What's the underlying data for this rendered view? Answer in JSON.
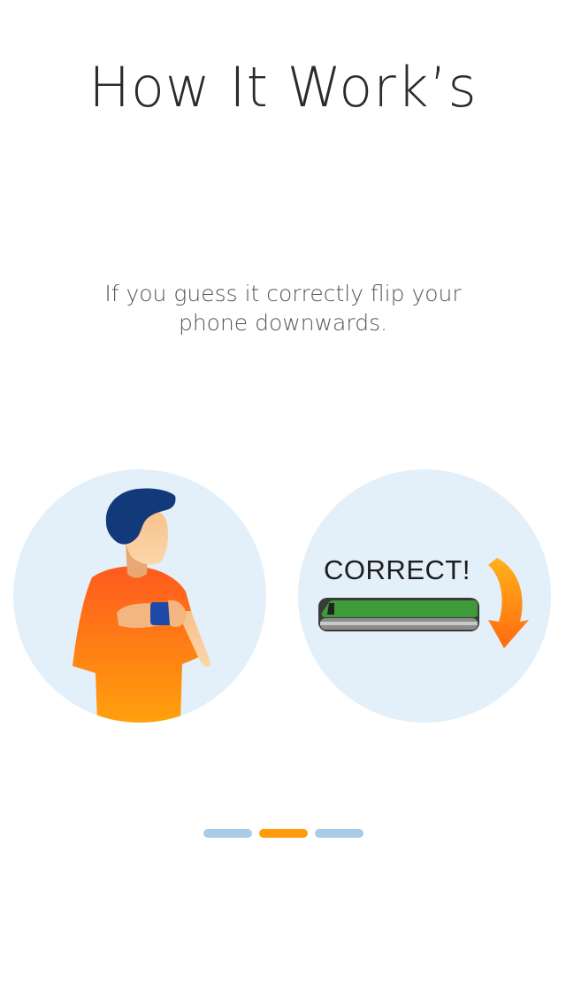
{
  "screen": {
    "title": "How It Work’s",
    "instruction": "If you guess it correctly flip your phone downwards.",
    "illustration": {
      "phone_screen_text": "CORRECT!",
      "person_icon": "person-holding-phone-icon",
      "phone_icon": "phone-face-down-icon",
      "arrow_icon": "curved-arrow-down-icon"
    },
    "pager": {
      "total_pages": 3,
      "active_page": 2
    },
    "colors": {
      "circle_background": "#e3eff9",
      "shirt_orange": "#ff6a1a",
      "hair_navy": "#123a7a",
      "phone_screen_green": "#3f9b3a",
      "arrow_orange": "#ff8a10",
      "pager_inactive": "#a9cbe6",
      "pager_active": "#ff9a0a"
    }
  }
}
